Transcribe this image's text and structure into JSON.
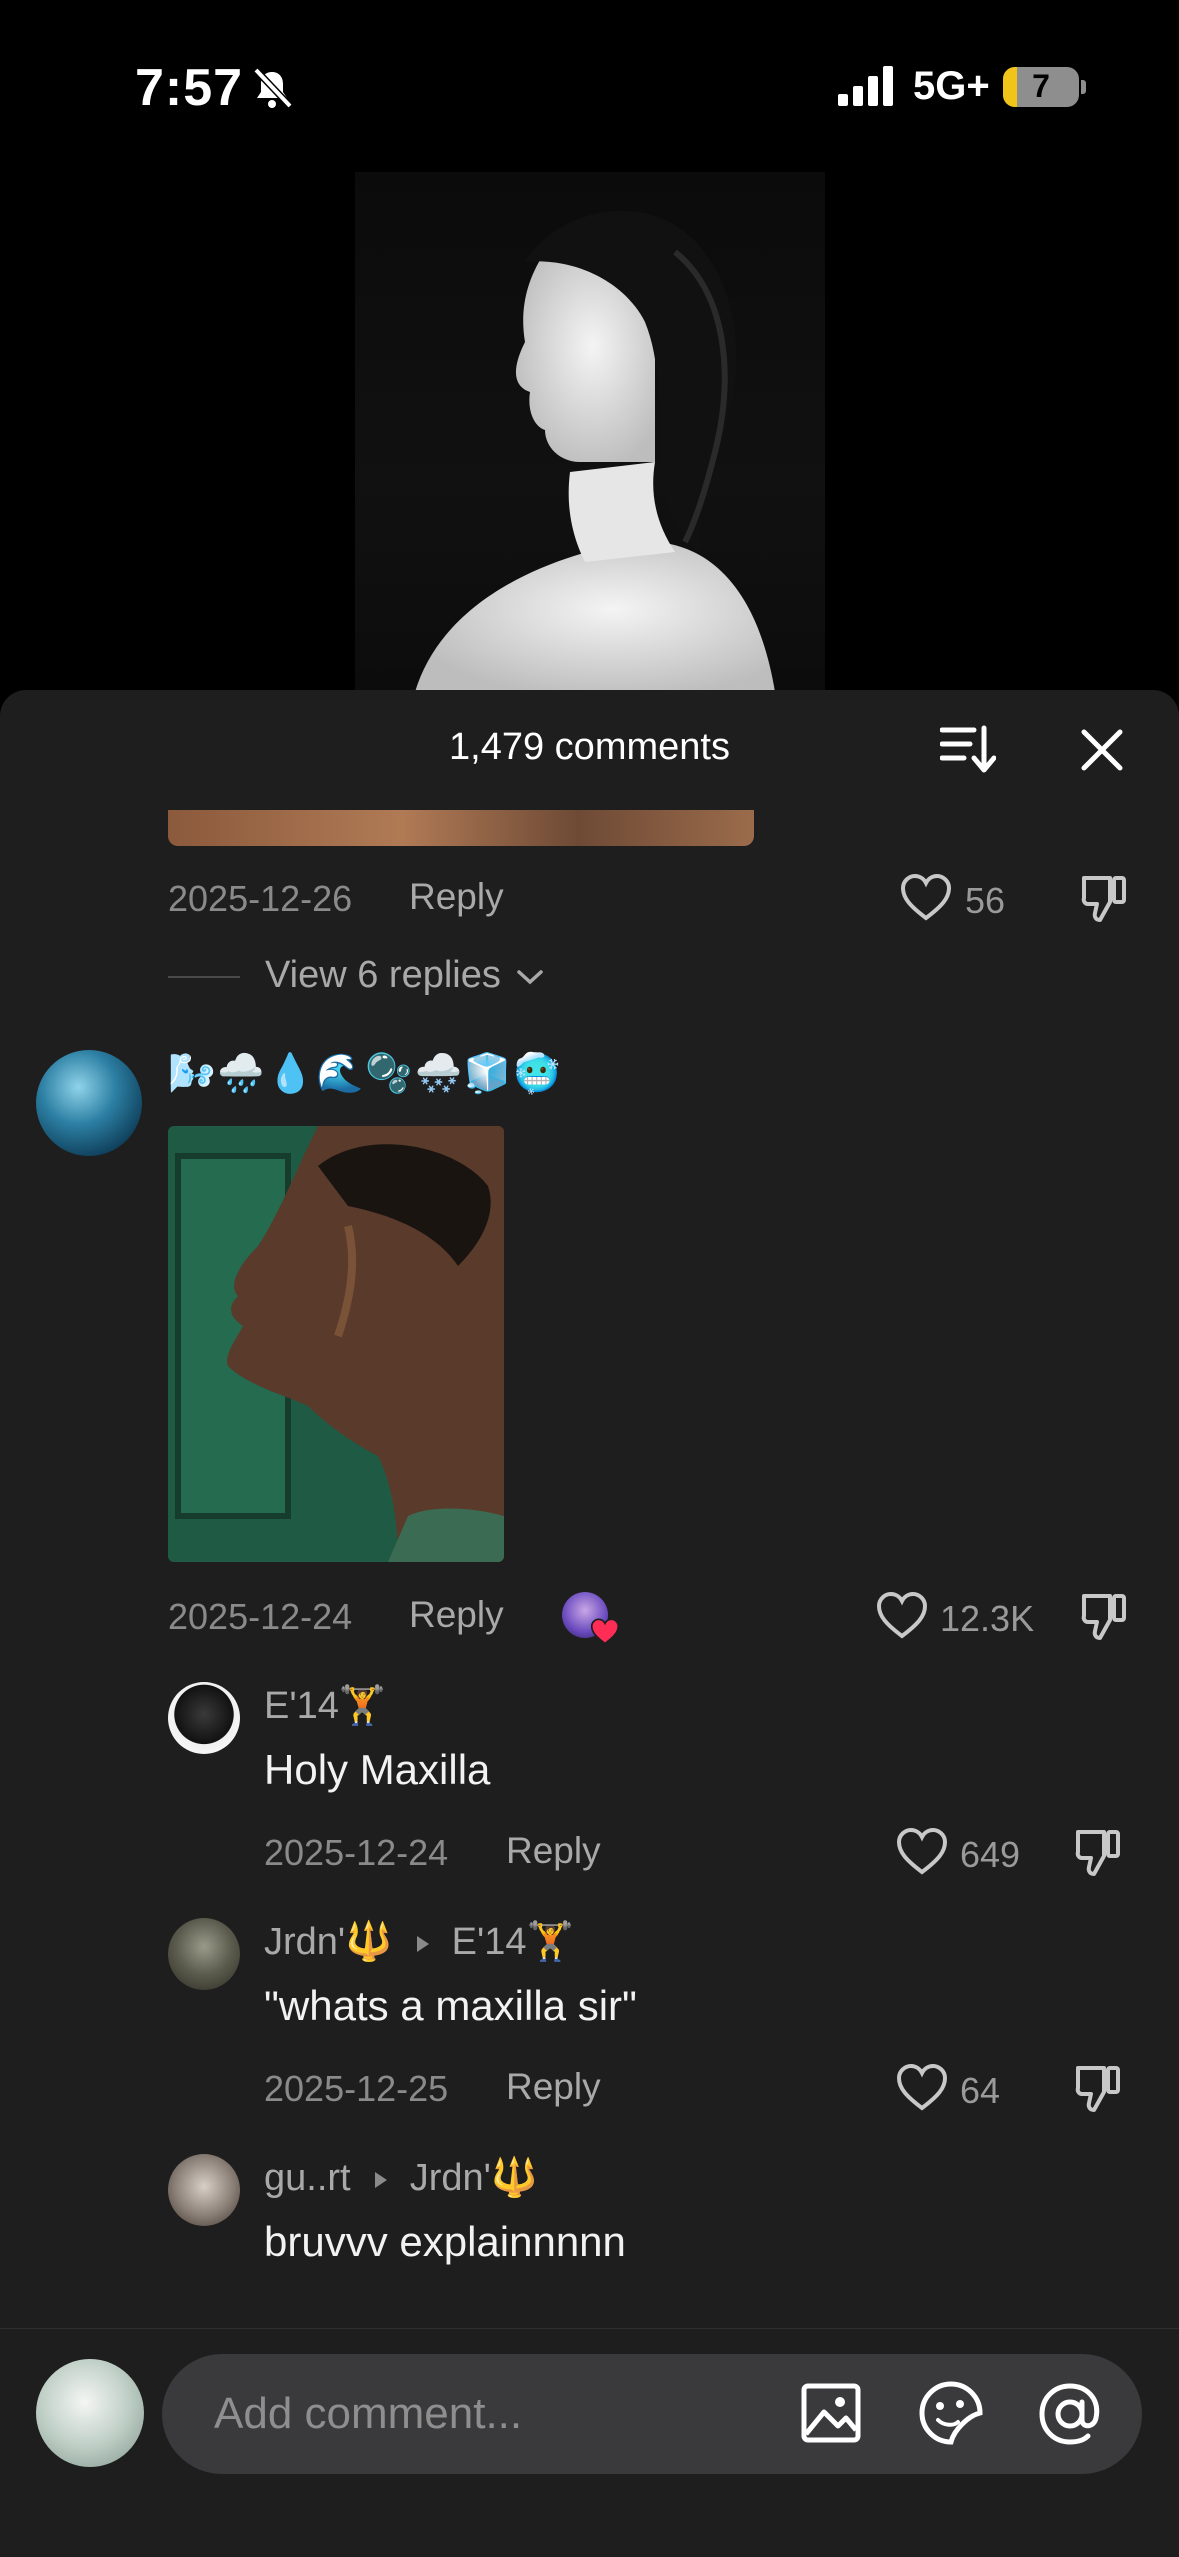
{
  "status_bar": {
    "time": "7:57",
    "network": "5G+",
    "battery": "7"
  },
  "header": {
    "title": "1,479 comments"
  },
  "comments": [
    {
      "date": "2025-12-26",
      "reply_label": "Reply",
      "likes": "56",
      "view_replies": "View 6 replies"
    },
    {
      "username": "🌬️🌧️💧🌊🫧🌨️🧊🥶",
      "date": "2025-12-24",
      "reply_label": "Reply",
      "likes": "12.3K"
    }
  ],
  "replies": [
    {
      "username": "E'14🏋️",
      "text": "Holy Maxilla",
      "date": "2025-12-24",
      "reply_label": "Reply",
      "likes": "649"
    },
    {
      "username": "Jrdn'🔱",
      "to": "E'14🏋️",
      "text": "\"whats a maxilla sir\"",
      "date": "2025-12-25",
      "reply_label": "Reply",
      "likes": "64"
    },
    {
      "username": "gu..rt",
      "to": "Jrdn'🔱",
      "text": "bruvvv explainnnnn"
    }
  ],
  "composer": {
    "placeholder": "Add comment..."
  },
  "colors": {
    "sheet": "#1e1e1f",
    "accent_heart": "#ff2d55",
    "muted": "#8a8a8a"
  }
}
